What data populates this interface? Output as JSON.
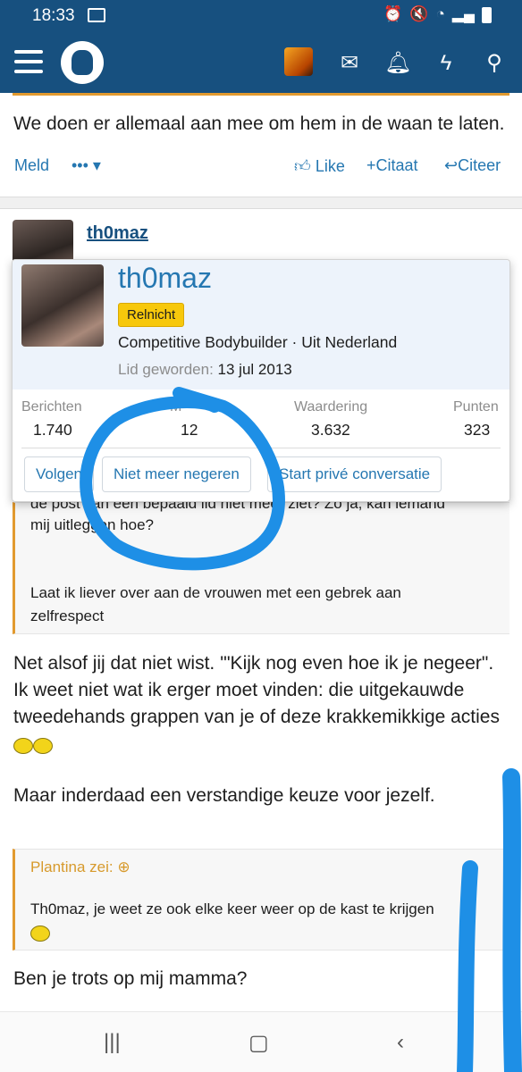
{
  "status": {
    "time": "18:33"
  },
  "post1": {
    "text": "We doen er allemaal aan mee om hem in de waan te laten.",
    "meld": "Meld",
    "more": "•••",
    "like": "Like",
    "citaat": "Citaat",
    "citeer": "Citeer"
  },
  "post2": {
    "author": "th0maz",
    "partial_role": "Competitive Bodybuilder",
    "partial_badge": "Relnicht"
  },
  "popup": {
    "name": "th0maz",
    "badge": "Relnicht",
    "role": "Competitive Bodybuilder · Uit Nederland",
    "since_label": "Lid geworden:",
    "since_date": "13 jul 2013",
    "stats": [
      {
        "label": "Berichten",
        "value": "1.740"
      },
      {
        "label": "M",
        "value": "12"
      },
      {
        "label": "Waardering",
        "value": "3.632"
      },
      {
        "label": "Punten",
        "value": "323"
      }
    ],
    "buttons": {
      "follow": "Volgen",
      "unignore": "Niet meer negeren",
      "conversation": "Start privé conversatie"
    }
  },
  "quote1": {
    "line1": "de post van een bepaald lid niet meer ziet? Zo ja, kan iemand",
    "line2": "mij uitleggen hoe?",
    "line3": "Laat ik liever over aan de vrouwen met een gebrek aan",
    "line4": "zelfrespect"
  },
  "reply": {
    "l1": "Net alsof jij dat niet wist. '\"Kijk nog even hoe ik je negeer\".",
    "l2": "Ik weet niet wat ik erger moet vinden: die uitgekauwde",
    "l3": "tweedehands grappen van je of deze krakkemikkige acties",
    "l4": "Maar inderdaad een verstandige keuze voor jezelf."
  },
  "quote2": {
    "author": "Plantina zei:",
    "text": "Th0maz, je weet ze ook elke keer weer op de kast te krijgen"
  },
  "last": {
    "text": "Ben je trots op mij mamma?"
  },
  "colors": {
    "header": "#17507f",
    "link": "#2577b1",
    "accent": "#e29a2f",
    "badge": "#f7c80c",
    "scribble": "#1e8fe6"
  }
}
